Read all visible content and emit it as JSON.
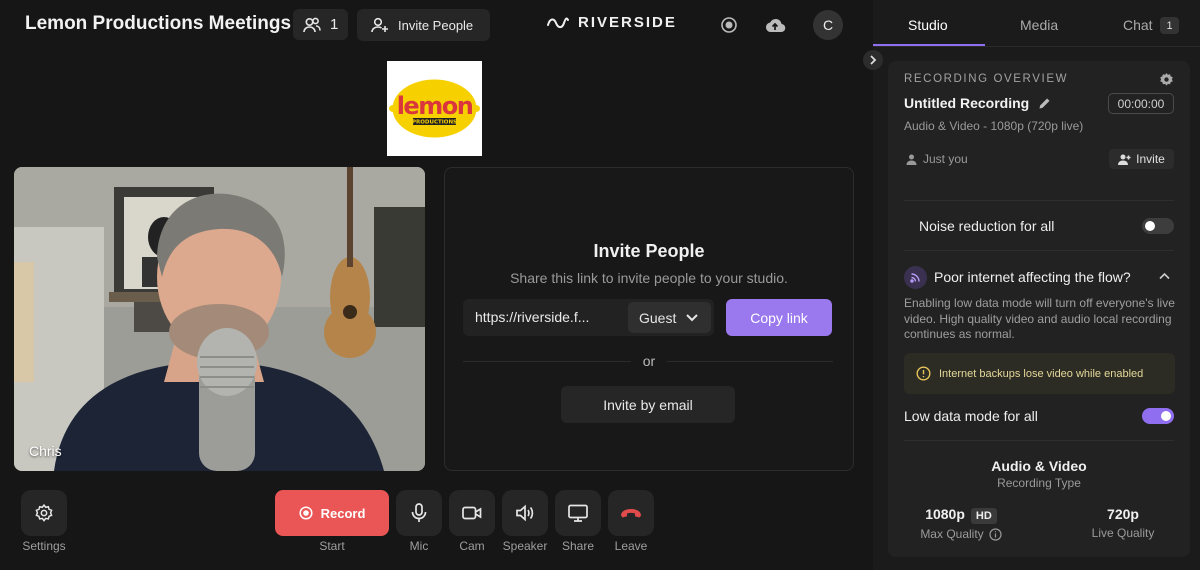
{
  "header": {
    "meeting_title": "Lemon Productions Meetings",
    "participant_count": "1",
    "invite_label": "Invite People",
    "brand_name": "RIVERSIDE",
    "avatar_initial": "C"
  },
  "logo": {
    "alt": "lemon productions logo",
    "brand_color": "#f7d000"
  },
  "video": {
    "participant_name": "Chris"
  },
  "invite_panel": {
    "title": "Invite People",
    "subtitle": "Share this link to invite people to your studio.",
    "link": "https://riverside.f...",
    "role": "Guest",
    "copy_label": "Copy link",
    "or_label": "or",
    "email_label": "Invite by email"
  },
  "toolbar": {
    "settings_label": "Settings",
    "record_label": "Record",
    "start_label": "Start",
    "mic_label": "Mic",
    "cam_label": "Cam",
    "speaker_label": "Speaker",
    "share_label": "Share",
    "leave_label": "Leave"
  },
  "sidebar": {
    "tabs": [
      {
        "label": "Studio"
      },
      {
        "label": "Media"
      },
      {
        "label": "Chat"
      }
    ],
    "chat_badge": "1",
    "overview": {
      "caption": "RECORDING OVERVIEW",
      "recording_title": "Untitled Recording",
      "timer": "00:00:00",
      "description": "Audio & Video - 1080p (720p live)",
      "participants": "Just you",
      "invite_label": "Invite"
    },
    "noise_reduction": {
      "label": "Noise reduction for all",
      "enabled": false
    },
    "poor_internet": {
      "title": "Poor internet affecting the flow?",
      "text": "Enabling low data mode will turn off everyone's live video. High quality video and audio local recording continues as normal.",
      "warning": "Internet backups lose video while enabled"
    },
    "low_data_mode": {
      "label": "Low data mode for all",
      "enabled": true
    },
    "recording_type": {
      "title": "Audio & Video",
      "subtitle": "Recording Type",
      "max_quality_value": "1080p",
      "hd_badge": "HD",
      "max_quality_label": "Max Quality",
      "live_quality_value": "720p",
      "live_quality_label": "Live Quality"
    }
  },
  "colors": {
    "accent": "#9a78ee",
    "record": "#ea5656",
    "leave_icon": "#e04b4b",
    "background": "#161616",
    "sidebar": "#1b1b1b"
  }
}
